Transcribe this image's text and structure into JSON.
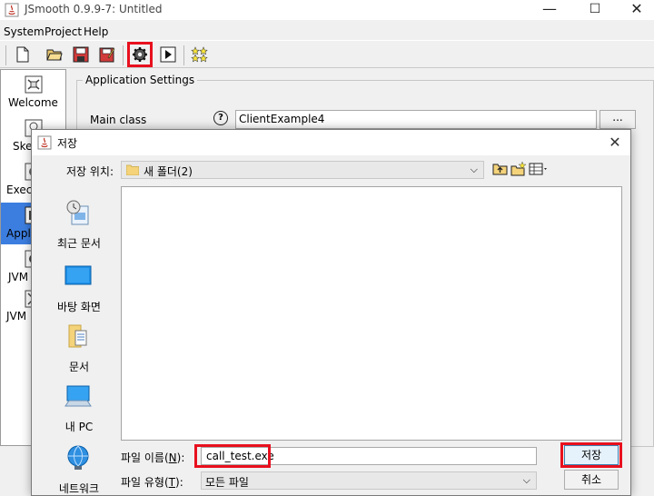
{
  "window": {
    "title": "JSmooth 0.9.9-7: Untitled",
    "minimize": "—",
    "maximize": "☐",
    "close": "✕"
  },
  "menubar": {
    "items": [
      "System",
      "Project",
      "Help"
    ]
  },
  "toolbar": {
    "buttons": [
      "new-file-icon",
      "open-folder-icon",
      "save-icon",
      "save-as-icon",
      "compile-gear-icon",
      "run-icon",
      "about-stars-icon"
    ],
    "highlighted": "compile-gear-icon"
  },
  "left_panel": {
    "items": [
      {
        "label": "Welcome",
        "icon": "welcome-icon"
      },
      {
        "label": "Skel",
        "icon": "skeleton-icon"
      },
      {
        "label": "Exec",
        "icon": "executable-icon"
      },
      {
        "label": "Appli",
        "icon": "application-icon",
        "selected": true
      },
      {
        "label": "JVM",
        "icon": "jvm-icon"
      },
      {
        "label": "JVM",
        "icon": "jvm-config-icon"
      }
    ]
  },
  "settings": {
    "group_title": "Application Settings",
    "main_class_label": "Main class",
    "main_class_value": "ClientExample4",
    "browse_label": "..."
  },
  "dialog": {
    "title": "저장",
    "close": "✕",
    "location_label": "저장 위치:",
    "location_value": "새 폴더(2)",
    "places": [
      {
        "label": "최근 문서",
        "icon": "recent-documents-icon"
      },
      {
        "label": "바탕 화면",
        "icon": "desktop-icon"
      },
      {
        "label": "문서",
        "icon": "documents-icon"
      },
      {
        "label": "내 PC",
        "icon": "my-pc-icon"
      },
      {
        "label": "네트워크",
        "icon": "network-icon"
      }
    ],
    "file_name_label_prefix": "파일 이름(",
    "file_name_mnemonic": "N",
    "file_name_label_suffix": "):",
    "file_name_value": "call_test.exe",
    "file_type_label_prefix": "파일 유형(",
    "file_type_mnemonic": "T",
    "file_type_label_suffix": "):",
    "file_type_value": "모든 파일",
    "save_button": "저장",
    "cancel_button": "취소"
  },
  "highlight_color": "#e8101e"
}
